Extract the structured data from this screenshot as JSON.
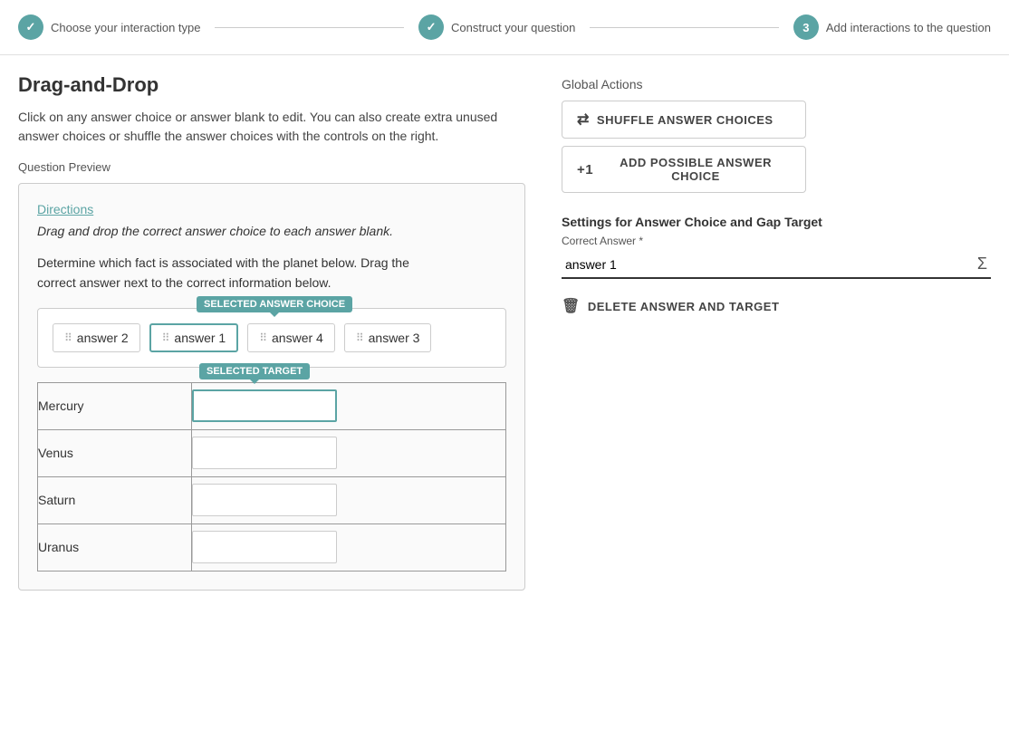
{
  "progress": {
    "step1": {
      "label": "Choose your interaction type",
      "status": "completed",
      "icon": "✓"
    },
    "step2": {
      "label": "Construct your question",
      "status": "completed",
      "icon": "✓"
    },
    "step3": {
      "label": "Add interactions to the question",
      "status": "active",
      "number": "3"
    }
  },
  "page": {
    "title": "Drag-and-Drop",
    "description": "Click on any answer choice or answer blank to edit. You can also create extra unused answer choices or shuffle the answer choices with the controls on the right.",
    "question_preview_label": "Question Preview"
  },
  "question": {
    "directions_link": "Directions",
    "directions_italic": "Drag and drop the correct answer choice to each answer blank.",
    "text_line1": "Determine which fact is associated with the planet below. Drag the",
    "text_line2": "correct answer next to the correct information below."
  },
  "tooltips": {
    "selected_answer": "SELECTED ANSWER CHOICE",
    "selected_target": "SELECTED TARGET"
  },
  "answer_choices": [
    {
      "id": "answer2",
      "label": "answer 2",
      "selected": false
    },
    {
      "id": "answer1",
      "label": "answer 1",
      "selected": true
    },
    {
      "id": "answer4",
      "label": "answer 4",
      "selected": false
    },
    {
      "id": "answer3",
      "label": "answer 3",
      "selected": false
    }
  ],
  "planets": [
    {
      "name": "Mercury",
      "target_selected": true
    },
    {
      "name": "Venus",
      "target_selected": false
    },
    {
      "name": "Saturn",
      "target_selected": false
    },
    {
      "name": "Uranus",
      "target_selected": false
    }
  ],
  "global_actions": {
    "label": "Global Actions",
    "shuffle_btn": "SHUFFLE ANSWER CHOICES",
    "add_btn": "ADD POSSIBLE ANSWER CHOICE"
  },
  "settings": {
    "title": "Settings for Answer Choice and Gap Target",
    "correct_answer_label": "Correct Answer *",
    "correct_answer_value": "answer 1",
    "delete_btn": "DELETE ANSWER AND TARGET"
  }
}
